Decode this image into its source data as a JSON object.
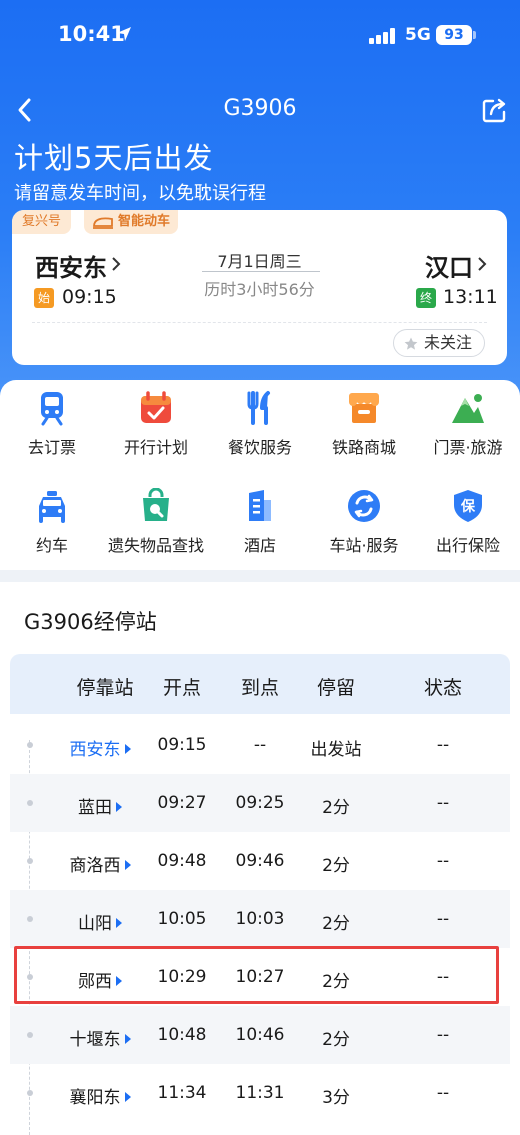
{
  "status_bar": {
    "time": "10:41",
    "network": "5G",
    "battery": "93"
  },
  "nav": {
    "title": "G3906"
  },
  "hero": {
    "headline": "计划5天后出发",
    "subline": "请留意发车时间，以免耽误行程"
  },
  "train": {
    "tag_fuxing": "复兴号",
    "tag_smart": "智能动车",
    "departure": {
      "station": "西安东",
      "badge": "始",
      "time": "09:15"
    },
    "arrival": {
      "station": "汉口",
      "badge": "终",
      "time": "13:11"
    },
    "date": "7月1日周三",
    "duration": "历时3小时56分",
    "follow_label": "未关注"
  },
  "services": [
    {
      "label": "去订票",
      "icon": "train-ticket-icon",
      "color": "#2e7cf6"
    },
    {
      "label": "开行计划",
      "icon": "calendar-icon",
      "color": "#ef4b3c"
    },
    {
      "label": "餐饮服务",
      "icon": "fork-knife-icon",
      "color": "#2e7cf6"
    },
    {
      "label": "铁路商城",
      "icon": "shop-icon",
      "color": "#f5892a"
    },
    {
      "label": "门票·旅游",
      "icon": "mountain-icon",
      "color": "#3cae52"
    },
    {
      "label": "约车",
      "icon": "taxi-icon",
      "color": "#2e7cf6"
    },
    {
      "label": "遗失物品查找",
      "icon": "lost-bag-icon",
      "color": "#27b08a"
    },
    {
      "label": "酒店",
      "icon": "hotel-icon",
      "color": "#2e7cf6"
    },
    {
      "label": "车站·服务",
      "icon": "station-service-icon",
      "color": "#2e7cf6"
    },
    {
      "label": "出行保险",
      "icon": "insurance-shield-icon",
      "color": "#2e7cf6"
    }
  ],
  "stops": {
    "title": "G3906经停站",
    "headers": {
      "station": "停靠站",
      "depart": "开点",
      "arrive": "到点",
      "stay": "停留",
      "status": "状态"
    },
    "rows": [
      {
        "station": "西安东",
        "depart": "09:15",
        "arrive": "--",
        "stay": "出发站",
        "status": "--"
      },
      {
        "station": "蓝田",
        "depart": "09:27",
        "arrive": "09:25",
        "stay": "2分",
        "status": "--"
      },
      {
        "station": "商洛西",
        "depart": "09:48",
        "arrive": "09:46",
        "stay": "2分",
        "status": "--"
      },
      {
        "station": "山阳",
        "depart": "10:05",
        "arrive": "10:03",
        "stay": "2分",
        "status": "--"
      },
      {
        "station": "郧西",
        "depart": "10:29",
        "arrive": "10:27",
        "stay": "2分",
        "status": "--"
      },
      {
        "station": "十堰东",
        "depart": "10:48",
        "arrive": "10:46",
        "stay": "2分",
        "status": "--"
      },
      {
        "station": "襄阳东",
        "depart": "11:34",
        "arrive": "11:31",
        "stay": "3分",
        "status": "--"
      }
    ]
  }
}
